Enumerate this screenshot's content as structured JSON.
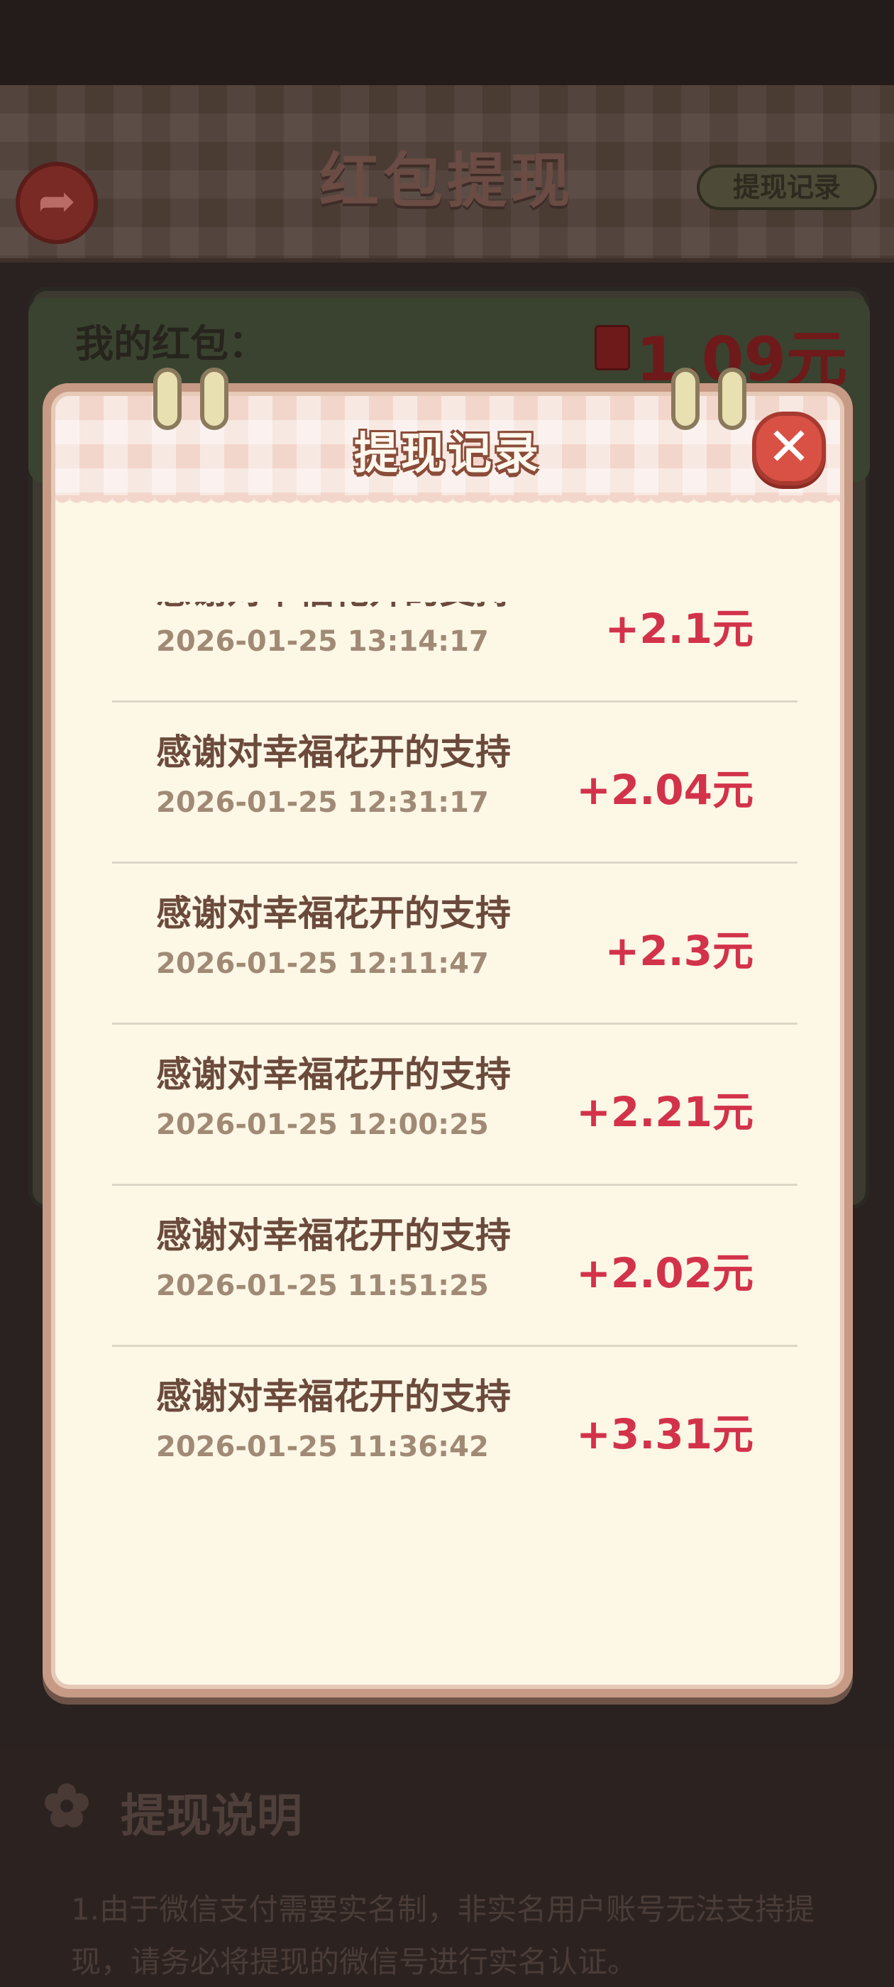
{
  "page": {
    "title": "红包提现",
    "records_button": "提现记录",
    "my_hongbao_label": "我的红包：",
    "balance": "1.09元",
    "explain_title": "提现说明",
    "explain_text": "1.由于微信支付需要实名制，非实名用户账号无法支持提现，请务必将提现的微信号进行实名认证。"
  },
  "modal": {
    "title": "提现记录",
    "records": [
      {
        "desc": "感谢对幸福花开的支持",
        "time": "2026-01-25 13:14:17",
        "amount": "+2.1元"
      },
      {
        "desc": "感谢对幸福花开的支持",
        "time": "2026-01-25 12:31:17",
        "amount": "+2.04元"
      },
      {
        "desc": "感谢对幸福花开的支持",
        "time": "2026-01-25 12:11:47",
        "amount": "+2.3元"
      },
      {
        "desc": "感谢对幸福花开的支持",
        "time": "2026-01-25 12:00:25",
        "amount": "+2.21元"
      },
      {
        "desc": "感谢对幸福花开的支持",
        "time": "2026-01-25 11:51:25",
        "amount": "+2.02元"
      },
      {
        "desc": "感谢对幸福花开的支持",
        "time": "2026-01-25 11:36:42",
        "amount": "+3.31元"
      }
    ]
  },
  "icons": {
    "back": "back-arrow-icon",
    "close": "close-icon",
    "hongbao": "red-envelope-icon",
    "flower": "flower-icon"
  },
  "colors": {
    "amount": "#d2334a",
    "close_button": "#d95145",
    "modal_background": "#fdf7e6"
  }
}
